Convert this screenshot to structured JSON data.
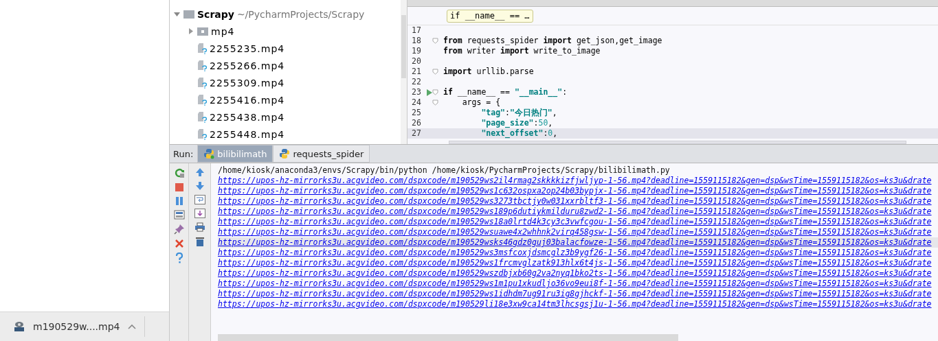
{
  "download_bar": {
    "file": "m190529w....mp4"
  },
  "project_tree": [
    {
      "kind": "root",
      "label": "Scrapy",
      "path": "~/PycharmProjects/Scrapy",
      "expanded": true,
      "children": [
        {
          "kind": "folder",
          "label": "mp4",
          "expanded": false
        },
        {
          "kind": "file",
          "label": "2255235.mp4"
        },
        {
          "kind": "file",
          "label": "2255266.mp4"
        },
        {
          "kind": "file",
          "label": "2255309.mp4"
        },
        {
          "kind": "file",
          "label": "2255416.mp4"
        },
        {
          "kind": "file",
          "label": "2255438.mp4"
        },
        {
          "kind": "file",
          "label": "2255448.mp4"
        }
      ]
    }
  ],
  "editor": {
    "breadcrumb": "if __name__ == …",
    "lines": [
      {
        "number": "17",
        "current": false
      },
      {
        "number": "18",
        "current": false,
        "fold": true,
        "tokens": [
          {
            "kind": "kw",
            "text": "from"
          },
          {
            "kind": "plain",
            "text": " requests_spider "
          },
          {
            "kind": "kw",
            "text": "import"
          },
          {
            "kind": "plain",
            "text": " get_json,get_image"
          }
        ]
      },
      {
        "number": "19",
        "current": false,
        "tokens": [
          {
            "kind": "kw",
            "text": "from"
          },
          {
            "kind": "plain",
            "text": " writer "
          },
          {
            "kind": "kw",
            "text": "import"
          },
          {
            "kind": "plain",
            "text": " write_to_image"
          }
        ]
      },
      {
        "number": "20",
        "current": false
      },
      {
        "number": "21",
        "current": false,
        "fold": true,
        "tokens": [
          {
            "kind": "kw",
            "text": "import"
          },
          {
            "kind": "plain",
            "text": " urllib.parse"
          }
        ]
      },
      {
        "number": "22",
        "current": false
      },
      {
        "number": "23",
        "current": false,
        "fold": true,
        "run": true,
        "tokens": [
          {
            "kind": "kw",
            "text": "if"
          },
          {
            "kind": "plain",
            "text": " __name__ == "
          },
          {
            "kind": "str",
            "text": "\"__main__\""
          },
          {
            "kind": "plain",
            "text": ":"
          }
        ]
      },
      {
        "number": "24",
        "current": false,
        "fold": true,
        "tokens": [
          {
            "kind": "plain",
            "text": "    args = {"
          }
        ]
      },
      {
        "number": "25",
        "current": false,
        "kind": "inner",
        "tokens": [
          {
            "kind": "str",
            "text": "\"tag\""
          },
          {
            "kind": "plain",
            "text": ":"
          },
          {
            "kind": "str",
            "text": "\"今日热门\""
          },
          {
            "kind": "plain",
            "text": ","
          }
        ]
      },
      {
        "number": "26",
        "current": false,
        "kind": "inner",
        "tokens": [
          {
            "kind": "str",
            "text": "\"page_size\""
          },
          {
            "kind": "plain",
            "text": ":"
          },
          {
            "kind": "num",
            "text": "50"
          },
          {
            "kind": "plain",
            "text": ","
          }
        ]
      },
      {
        "number": "27",
        "current": true,
        "kind": "inner",
        "tokens": [
          {
            "kind": "str",
            "text": "\"next_offset\""
          },
          {
            "kind": "plain",
            "text": ":"
          },
          {
            "kind": "num",
            "text": "0"
          },
          {
            "kind": "plain",
            "text": ","
          }
        ]
      }
    ]
  },
  "run_panel": {
    "label": "Run:",
    "tabs": [
      {
        "label": "bilibilimath",
        "selected": true
      },
      {
        "label": "requests_spider",
        "selected": false
      }
    ],
    "output": [
      {
        "kind": "command",
        "current": false,
        "text": "/home/kiosk/anaconda3/envs/Scrapy/bin/python /home/kiosk/PycharmProjects/Scrapy/bilibilimath.py"
      },
      {
        "kind": "link",
        "current": false,
        "text": "https://upos-hz-mirrorks3u.acgvideo.com/dspxcode/m190529ws2il4rmag2skkkkizfjwljyp-1-56.mp4?deadline=1559115182&gen=dsp&wsTime=1559115182&os=ks3u&drate"
      },
      {
        "kind": "link",
        "current": false,
        "text": "https://upos-hz-mirrorks3u.acgvideo.com/dspxcode/m190529ws1c632ospxa2op24b03bypjx-1-56.mp4?deadline=1559115182&gen=dsp&wsTime=1559115182&os=ks3u&drate"
      },
      {
        "kind": "link",
        "current": false,
        "text": "https://upos-hz-mirrorks3u.acgvideo.com/dspxcode/m190529ws3273tbctjy0w031xxrbltf3-1-56.mp4?deadline=1559115182&gen=dsp&wsTime=1559115182&os=ks3u&drate"
      },
      {
        "kind": "link",
        "current": false,
        "text": "https://upos-hz-mirrorks3u.acgvideo.com/dspxcode/m190529ws189p6dutiykmilduru8zwd2-1-56.mp4?deadline=1559115182&gen=dsp&wsTime=1559115182&os=ks3u&drate"
      },
      {
        "kind": "link",
        "current": false,
        "text": "https://upos-hz-mirrorks3u.acgvideo.com/dspxcode/m190529ws18a0lrtd4k3cy3c3vwfcgou-1-56.mp4?deadline=1559115182&gen=dsp&wsTime=1559115182&os=ks3u&drate"
      },
      {
        "kind": "link",
        "current": false,
        "text": "https://upos-hz-mirrorks3u.acgvideo.com/dspxcode/m190529wsuawe4x2whhnk2virq458gsw-1-56.mp4?deadline=1559115182&gen=dsp&wsTime=1559115182&os=ks3u&drate"
      },
      {
        "kind": "link",
        "current": true,
        "text": "https://upos-hz-mirrorks3u.acgvideo.com/dspxcode/m190529wsks46gdz0guj03balacfowze-1-56.mp4?deadline=1559115182&gen=dsp&wsTime=1559115182&os=ks3u&drate"
      },
      {
        "kind": "link",
        "current": false,
        "text": "https://upos-hz-mirrorks3u.acgvideo.com/dspxcode/m190529ws3msfcoxjdsmcglz3b9ygf26-1-56.mp4?deadline=1559115182&gen=dsp&wsTime=1559115182&os=ks3u&drate"
      },
      {
        "kind": "link",
        "current": false,
        "text": "https://upos-hz-mirrorks3u.acgvideo.com/dspxcode/m190529ws1frcmvglzatk913hlx6t4js-1-56.mp4?deadline=1559115182&gen=dsp&wsTime=1559115182&os=ks3u&drate"
      },
      {
        "kind": "link",
        "current": false,
        "text": "https://upos-hz-mirrorks3u.acgvideo.com/dspxcode/m190529wszdbjxb60g2va2nyq1bko2ts-1-56.mp4?deadline=1559115182&gen=dsp&wsTime=1559115182&os=ks3u&drate"
      },
      {
        "kind": "link",
        "current": false,
        "text": "https://upos-hz-mirrorks3u.acgvideo.com/dspxcode/m190529ws1m1pu1xkudljo36vo9eui8f-1-56.mp4?deadline=1559115182&gen=dsp&wsTime=1559115182&os=ks3u&drate"
      },
      {
        "kind": "link",
        "current": false,
        "text": "https://upos-hz-mirrorks3u.acgvideo.com/dspxcode/m190529ws1idhdm7ug91ru3ig8gjhckf-1-56.mp4?deadline=1559115182&gen=dsp&wsTime=1559115182&os=ks3u&drate"
      },
      {
        "kind": "link",
        "current": false,
        "text": "https://upos-hz-mirrorks3u.acgvideo.com/dspxcode/m190529li18e3xw9ca14tm3lhcsgsj1u-1-56.mp4?deadline=1559115182&gen=dsp&wsTime=1559115182&os=ks3u&drate"
      }
    ]
  }
}
